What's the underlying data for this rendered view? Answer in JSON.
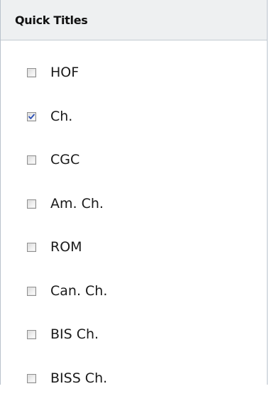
{
  "panel": {
    "title": "Quick Titles"
  },
  "options": [
    {
      "label": "HOF",
      "checked": false
    },
    {
      "label": "Ch.",
      "checked": true
    },
    {
      "label": "CGC",
      "checked": false
    },
    {
      "label": "Am. Ch.",
      "checked": false
    },
    {
      "label": "ROM",
      "checked": false
    },
    {
      "label": "Can. Ch.",
      "checked": false
    },
    {
      "label": "BIS Ch.",
      "checked": false
    },
    {
      "label": "BISS Ch.",
      "checked": false
    }
  ],
  "colors": {
    "check": "#2b4fb5",
    "header_bg": "#eef0f1",
    "border": "#b9c2cc"
  }
}
